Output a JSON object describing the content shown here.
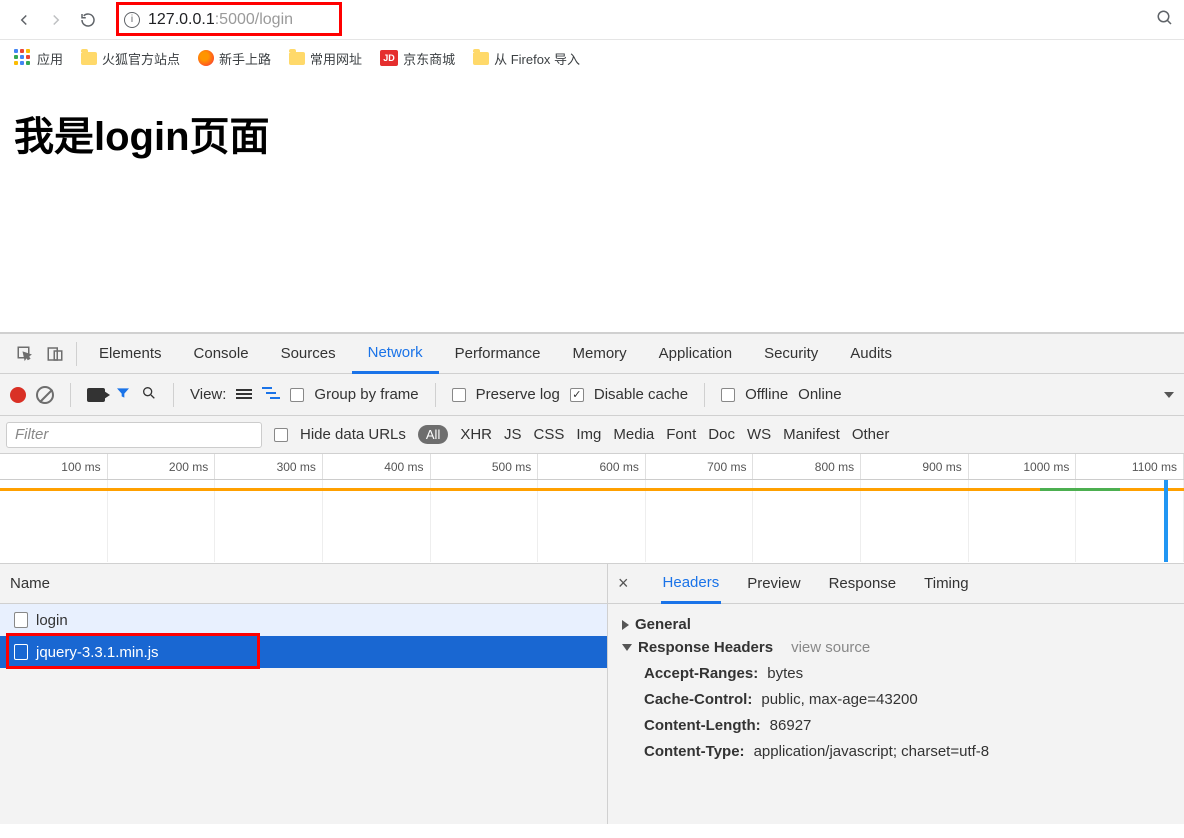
{
  "toolbar": {
    "url_host": "127.0.0.1",
    "url_port_path": ":5000/login",
    "info": "i"
  },
  "bookmarks": {
    "apps": "应用",
    "items": [
      "火狐官方站点",
      "新手上路",
      "常用网址",
      "京东商城",
      "从 Firefox 导入"
    ],
    "jd": "JD"
  },
  "page": {
    "heading": "我是login页面"
  },
  "devtools": {
    "tabs": [
      "Elements",
      "Console",
      "Sources",
      "Network",
      "Performance",
      "Memory",
      "Application",
      "Security",
      "Audits"
    ],
    "active_tab": "Network",
    "controls": {
      "view": "View:",
      "group": "Group by frame",
      "preserve": "Preserve log",
      "disable": "Disable cache",
      "offline": "Offline",
      "online": "Online"
    },
    "filter": {
      "placeholder": "Filter",
      "hide": "Hide data URLs",
      "types": [
        "All",
        "XHR",
        "JS",
        "CSS",
        "Img",
        "Media",
        "Font",
        "Doc",
        "WS",
        "Manifest",
        "Other"
      ]
    },
    "waterfall_ticks": [
      "100 ms",
      "200 ms",
      "300 ms",
      "400 ms",
      "500 ms",
      "600 ms",
      "700 ms",
      "800 ms",
      "900 ms",
      "1000 ms",
      "1100 ms"
    ],
    "name_header": "Name",
    "requests": [
      {
        "name": "login"
      },
      {
        "name": "jquery-3.3.1.min.js"
      }
    ],
    "detail_tabs": [
      "Headers",
      "Preview",
      "Response",
      "Timing"
    ],
    "sections": {
      "general": "General",
      "response_headers": "Response Headers",
      "view_source": "view source"
    },
    "headers": [
      {
        "k": "Accept-Ranges:",
        "v": "bytes"
      },
      {
        "k": "Cache-Control:",
        "v": "public, max-age=43200"
      },
      {
        "k": "Content-Length:",
        "v": "86927"
      },
      {
        "k": "Content-Type:",
        "v": "application/javascript; charset=utf-8"
      }
    ]
  }
}
